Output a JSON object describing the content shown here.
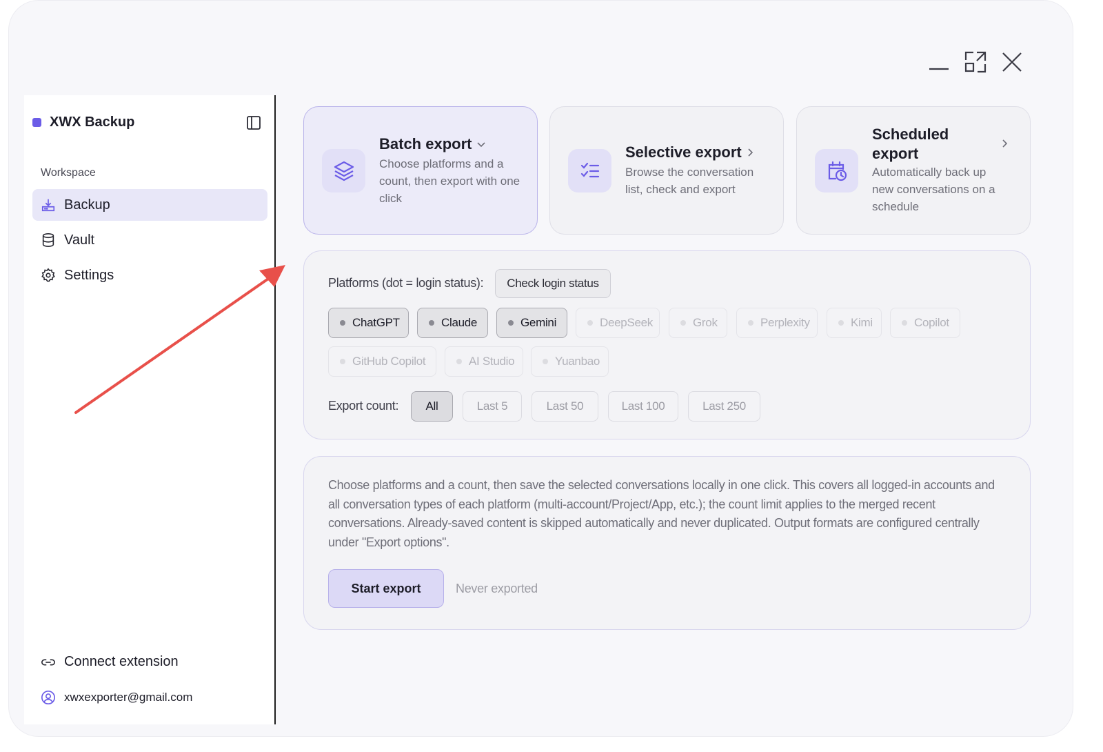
{
  "app": {
    "title": "XWX Backup",
    "accent": "#6b5ce7"
  },
  "window_controls": {
    "minimize": "minimize-icon",
    "maximize": "maximize-icon",
    "close": "close-icon"
  },
  "sidebar": {
    "section_label": "Workspace",
    "items": [
      {
        "label": "Backup",
        "icon": "download-tray-icon",
        "active": true
      },
      {
        "label": "Vault",
        "icon": "database-icon",
        "active": false
      },
      {
        "label": "Settings",
        "icon": "gear-icon",
        "active": false
      }
    ],
    "connect_label": "Connect extension",
    "account_email": "xwxexporter@gmail.com"
  },
  "modes": [
    {
      "title": "Batch export",
      "desc": "Choose platforms and a count, then export with one click",
      "icon": "layers-icon",
      "active": true
    },
    {
      "title": "Selective export",
      "desc": "Browse the conversation list, check and export",
      "icon": "checklist-icon",
      "active": false
    },
    {
      "title": "Scheduled export",
      "desc": "Automatically back up new conversations on a schedule",
      "icon": "calendar-clock-icon",
      "active": false
    }
  ],
  "options": {
    "platforms_label": "Platforms (dot = login status):",
    "check_login_label": "Check login status",
    "platforms": [
      {
        "name": "ChatGPT",
        "selected": true
      },
      {
        "name": "Claude",
        "selected": true
      },
      {
        "name": "Gemini",
        "selected": true
      },
      {
        "name": "DeepSeek",
        "selected": false
      },
      {
        "name": "Grok",
        "selected": false
      },
      {
        "name": "Perplexity",
        "selected": false
      },
      {
        "name": "Kimi",
        "selected": false
      },
      {
        "name": "Copilot",
        "selected": false
      },
      {
        "name": "GitHub Copilot",
        "selected": false
      },
      {
        "name": "AI Studio",
        "selected": false
      },
      {
        "name": "Yuanbao",
        "selected": false
      }
    ],
    "count_label": "Export count:",
    "counts": [
      {
        "label": "All",
        "selected": true
      },
      {
        "label": "Last 5",
        "selected": false
      },
      {
        "label": "Last 50",
        "selected": false
      },
      {
        "label": "Last 100",
        "selected": false
      },
      {
        "label": "Last 250",
        "selected": false
      }
    ]
  },
  "info": {
    "text": "Choose platforms and a count, then save the selected conversations locally in one click. This covers all logged-in accounts and all conversation types of each platform (multi-account/Project/App, etc.); the count limit applies to the merged recent conversations. Already-saved content is skipped automatically and never duplicated. Output formats are configured centrally under \"Export options\".",
    "start_label": "Start export",
    "status": "Never exported"
  },
  "annotation": {
    "color": "#e8504a"
  }
}
